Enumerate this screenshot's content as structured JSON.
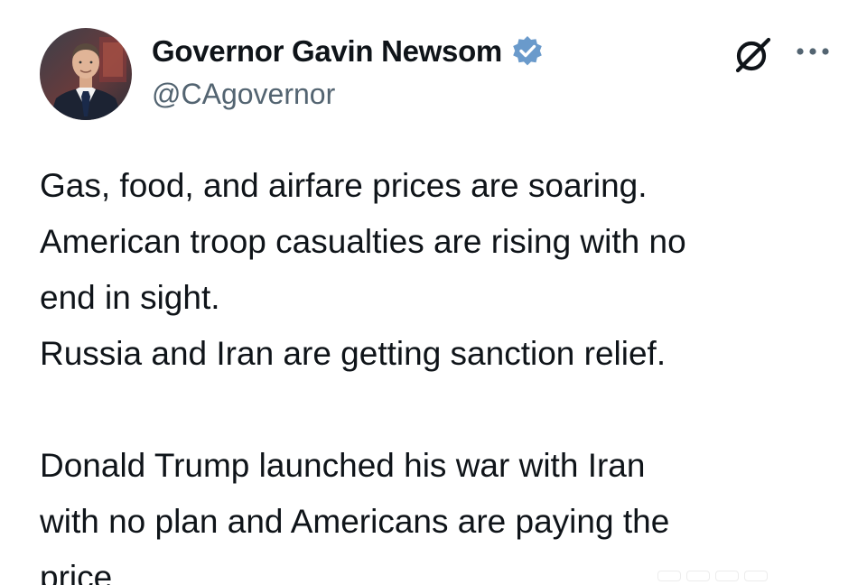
{
  "author": {
    "display_name": "Governor Gavin Newsom",
    "handle": "@CAgovernor",
    "verified_badge_color": "#1d9bf0",
    "avatar_icon": "profile-photo"
  },
  "actions": {
    "grok_icon": "grok-icon",
    "more_icon": "more-options-icon"
  },
  "tweet": {
    "lines": [
      "Gas, food, and airfare prices are soaring.",
      "American troop casualties are rising with no",
      "end in sight.",
      "Russia and Iran are getting sanction relief.",
      "",
      "Donald Trump launched his war with Iran",
      "with no plan and Americans are paying the",
      "price."
    ]
  },
  "colors": {
    "text": "#0f1419",
    "secondary_text": "#536471",
    "accent": "#1d9bf0"
  }
}
